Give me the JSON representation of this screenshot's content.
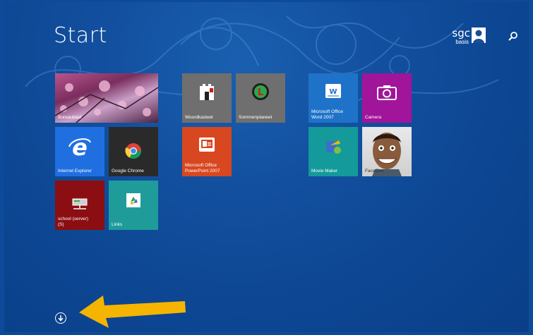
{
  "start": {
    "title": "Start"
  },
  "user": {
    "name": "sgc",
    "subtitle": "basis"
  },
  "tiles": {
    "desktop": "Bureaublad",
    "ie": "Internet Explorer",
    "chrome": "Google Chrome",
    "school": "school (server)\n(S)",
    "links": "Links",
    "woordkasteel": "Woordkasteel",
    "sommenplaneet": "Sommenplaneet",
    "powerpoint": "Microsoft Office PowerPoint 2007",
    "word": "Microsoft Office Word 2007",
    "camera": "Camera",
    "moviemaker": "Movie Maker",
    "facegoo": "FaceGoo"
  },
  "colors": {
    "background": "#0d4b9a",
    "arrow": "#f5b400"
  },
  "icons": [
    "search-icon",
    "user-avatar-icon",
    "all-apps-down-arrow-icon",
    "internet-explorer-icon",
    "chrome-icon",
    "word-icon",
    "powerpoint-icon",
    "camera-icon",
    "movie-maker-icon",
    "network-drive-icon",
    "links-icon"
  ]
}
